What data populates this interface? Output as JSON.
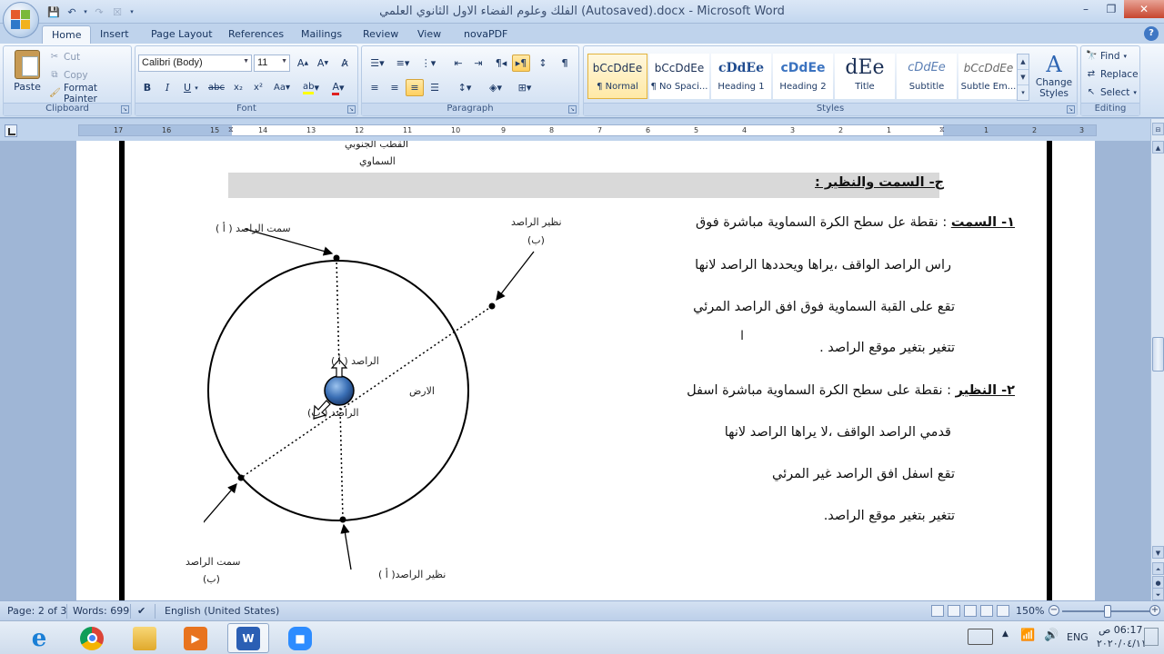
{
  "window": {
    "title": "الفلك وعلوم الفضاء الاول الثانوي العلمي (Autosaved).docx - Microsoft Word",
    "minimize": "–",
    "restore": "❐",
    "close": "✕"
  },
  "tabs": [
    "Home",
    "Insert",
    "Page Layout",
    "References",
    "Mailings",
    "Review",
    "View",
    "novaPDF"
  ],
  "ribbon": {
    "clipboard": {
      "label": "Clipboard",
      "paste": "Paste",
      "cut": "Cut",
      "copy": "Copy",
      "format_painter": "Format Painter"
    },
    "font": {
      "label": "Font",
      "font_name": "Calibri (Body)",
      "font_size": "11"
    },
    "paragraph": {
      "label": "Paragraph"
    },
    "styles": {
      "label": "Styles",
      "items": [
        {
          "preview": "bCcDdEe",
          "name": "¶ Normal"
        },
        {
          "preview": "bCcDdEe",
          "name": "¶ No Spaci..."
        },
        {
          "preview": "cDdEe",
          "name": "Heading 1"
        },
        {
          "preview": "cDdEe",
          "name": "Heading 2"
        },
        {
          "preview": "dEe",
          "name": "Title"
        },
        {
          "preview": "cDdEe",
          "name": "Subtitle"
        },
        {
          "preview": "bCcDdEe",
          "name": "Subtle Em..."
        }
      ],
      "change_styles": "Change Styles"
    },
    "editing": {
      "label": "Editing",
      "find": "Find",
      "replace": "Replace",
      "select": "Select"
    }
  },
  "ruler": {
    "ticks": [
      "17",
      "16",
      "15",
      "14",
      "13",
      "12",
      "11",
      "10",
      "9",
      "8",
      "7",
      "6",
      "5",
      "4",
      "3",
      "2",
      "1",
      "1",
      "2",
      "3"
    ]
  },
  "document": {
    "top_label_1": "القطب الجنوبي",
    "top_label_2": "السماوي",
    "heading": "ج- السمت والنظير :",
    "para1_lead": "١- السمت",
    "para1_rest": " : نقطة عل سطح الكرة السماوية مباشرة فوق",
    "para1_line2": "راس الراصد الواقف ،يراها ويحددها الراصد لانها",
    "para1_line3": "تقع على القبة السماوية فوق افق الراصد المرئي",
    "para1_line4": "تتغير بتغير موقع الراصد .",
    "para2_lead": "٢- النظير",
    "para2_rest": " : نقطة على سطح الكرة السماوية مباشرة اسفل",
    "para2_line2": "قدمي الراصد الواقف ،لا يراها الراصد لانها",
    "para2_line3": "تقع اسفل افق الراصد غير المرئي",
    "para2_line4": "تتغير بتغير موقع الراصد.",
    "diagram": {
      "zenith_a": "سمت الراصد ( أ )",
      "nadir_b": "نظير الراصد",
      "nadir_b2": "(ب)",
      "observer_a": "الراصد ( أ )",
      "observer_b": "الراصد ( ب)",
      "earth": "الارض",
      "zenith_b": "سمت الراصد",
      "zenith_b2": "(ب)",
      "nadir_a": "نظير الراصد( أ )"
    }
  },
  "statusbar": {
    "page": "Page: 2 of 3",
    "words": "Words: 699",
    "language": "English (United States)",
    "zoom": "150%"
  },
  "taskbar": {
    "lang": "ENG",
    "time": "06:17 ص",
    "date": "٢٠٢٠/٠٤/١١"
  }
}
